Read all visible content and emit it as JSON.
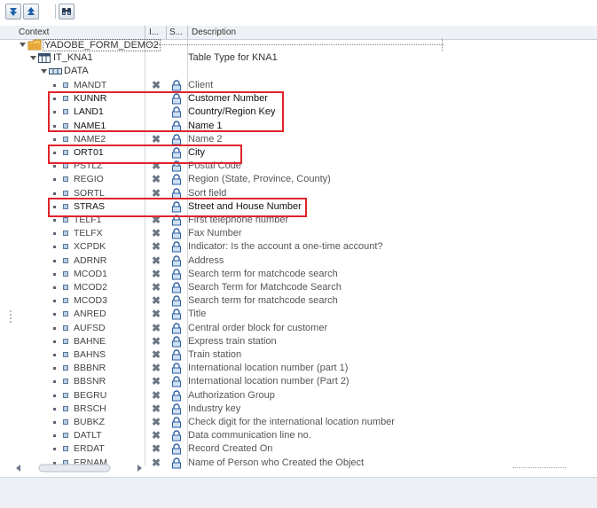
{
  "header": {
    "context": "Context",
    "col_i": "I...",
    "col_s": "S...",
    "description": "Description"
  },
  "tree": {
    "root": "YADOBE_FORM_DEMO2",
    "table": "IT_KNA1",
    "table_desc": "Table Type for KNA1",
    "data_node": "DATA"
  },
  "fields": [
    {
      "name": "MANDT",
      "desc": "Client"
    },
    {
      "name": "KUNNR",
      "desc": "Customer Number"
    },
    {
      "name": "LAND1",
      "desc": "Country/Region Key"
    },
    {
      "name": "NAME1",
      "desc": "Name 1"
    },
    {
      "name": "NAME2",
      "desc": "Name 2"
    },
    {
      "name": "ORT01",
      "desc": "City"
    },
    {
      "name": "PSTLZ",
      "desc": "Postal Code"
    },
    {
      "name": "REGIO",
      "desc": "Region (State, Province, County)"
    },
    {
      "name": "SORTL",
      "desc": "Sort field"
    },
    {
      "name": "STRAS",
      "desc": "Street and House Number"
    },
    {
      "name": "TELF1",
      "desc": "First telephone number"
    },
    {
      "name": "TELFX",
      "desc": "Fax Number"
    },
    {
      "name": "XCPDK",
      "desc": "Indicator: Is the account a one-time account?"
    },
    {
      "name": "ADRNR",
      "desc": "Address"
    },
    {
      "name": "MCOD1",
      "desc": "Search term for matchcode search"
    },
    {
      "name": "MCOD2",
      "desc": "Search Term for Matchcode Search"
    },
    {
      "name": "MCOD3",
      "desc": "Search term for matchcode search"
    },
    {
      "name": "ANRED",
      "desc": "Title"
    },
    {
      "name": "AUFSD",
      "desc": "Central order block for customer"
    },
    {
      "name": "BAHNE",
      "desc": "Express train station"
    },
    {
      "name": "BAHNS",
      "desc": "Train station"
    },
    {
      "name": "BBBNR",
      "desc": "International location number  (part 1)"
    },
    {
      "name": "BBSNR",
      "desc": "International location number (Part 2)"
    },
    {
      "name": "BEGRU",
      "desc": "Authorization Group"
    },
    {
      "name": "BRSCH",
      "desc": "Industry key"
    },
    {
      "name": "BUBKZ",
      "desc": "Check digit for the international location number"
    },
    {
      "name": "DATLT",
      "desc": "Data communication line no."
    },
    {
      "name": "ERDAT",
      "desc": "Record Created On"
    },
    {
      "name": "ERNAM",
      "desc": "Name of Person who Created the Object"
    }
  ],
  "colors": {
    "highlight": "#e0232b",
    "folder": "#e9a83a"
  }
}
